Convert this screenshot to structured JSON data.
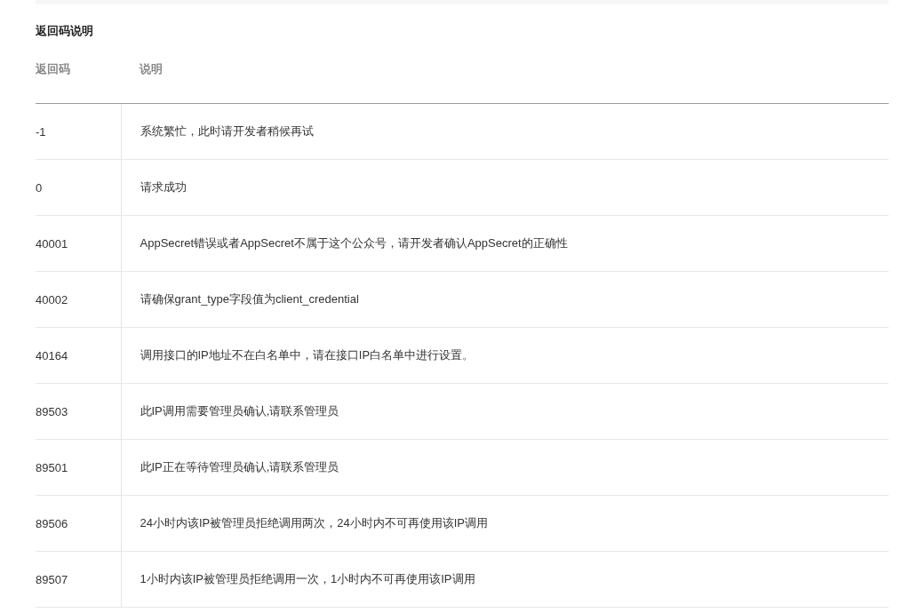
{
  "section_title": "返回码说明",
  "table": {
    "columns": [
      "返回码",
      "说明"
    ],
    "rows": [
      {
        "code": "-1",
        "description": "系统繁忙，此时请开发者稍候再试"
      },
      {
        "code": "0",
        "description": "请求成功"
      },
      {
        "code": "40001",
        "description": "AppSecret错误或者AppSecret不属于这个公众号，请开发者确认AppSecret的正确性"
      },
      {
        "code": "40002",
        "description": "请确保grant_type字段值为client_credential"
      },
      {
        "code": "40164",
        "description": "调用接口的IP地址不在白名单中，请在接口IP白名单中进行设置。"
      },
      {
        "code": "89503",
        "description": "此IP调用需要管理员确认,请联系管理员"
      },
      {
        "code": "89501",
        "description": "此IP正在等待管理员确认,请联系管理员"
      },
      {
        "code": "89506",
        "description": "24小时内该IP被管理员拒绝调用两次，24小时内不可再使用该IP调用"
      },
      {
        "code": "89507",
        "description": "1小时内该IP被管理员拒绝调用一次，1小时内不可再使用该IP调用"
      }
    ]
  }
}
